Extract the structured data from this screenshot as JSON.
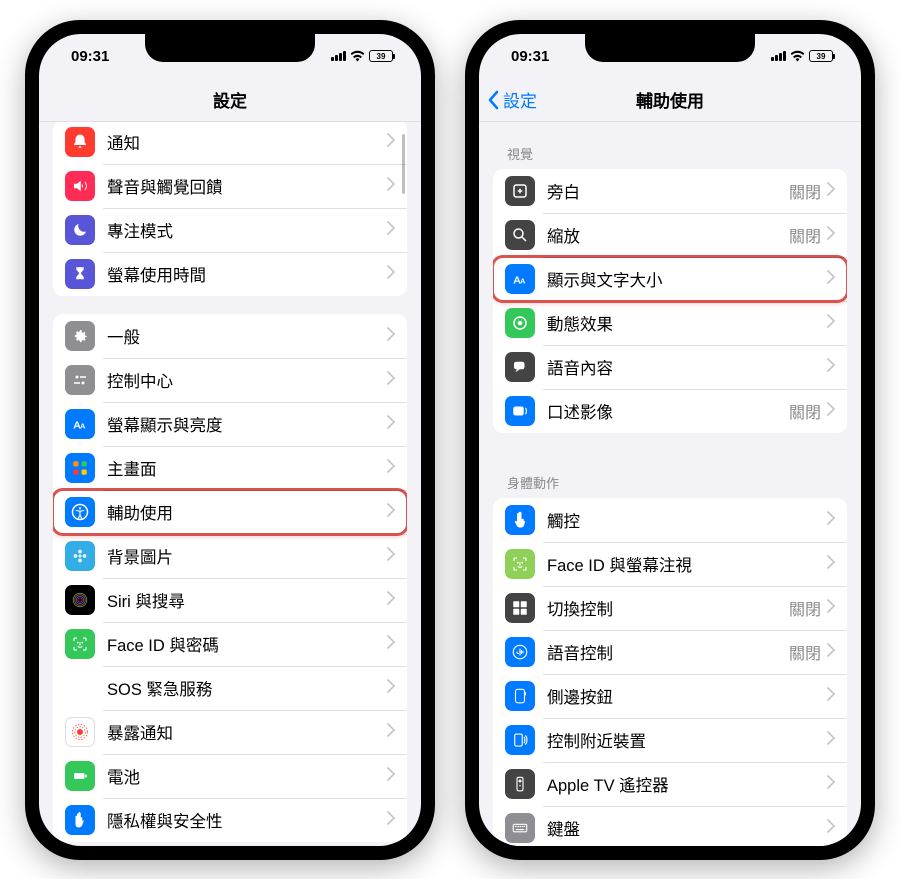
{
  "status": {
    "time": "09:31",
    "battery": "39"
  },
  "left": {
    "title": "設定",
    "groups": [
      {
        "rows": [
          {
            "name": "notifications",
            "icon": "bell-icon",
            "bg": "bg-red",
            "label": "通知"
          },
          {
            "name": "sounds",
            "icon": "speaker-icon",
            "bg": "bg-pink",
            "label": "聲音與觸覺回饋"
          },
          {
            "name": "focus",
            "icon": "moon-icon",
            "bg": "bg-purple",
            "label": "專注模式"
          },
          {
            "name": "screen-time",
            "icon": "hourglass-icon",
            "bg": "bg-purple",
            "label": "螢幕使用時間"
          }
        ]
      },
      {
        "rows": [
          {
            "name": "general",
            "icon": "gear-icon",
            "bg": "bg-gray",
            "label": "一般"
          },
          {
            "name": "control-center",
            "icon": "switches-icon",
            "bg": "bg-gray",
            "label": "控制中心"
          },
          {
            "name": "display",
            "icon": "text-size-icon",
            "bg": "bg-blue",
            "label": "螢幕顯示與亮度"
          },
          {
            "name": "home-screen",
            "icon": "grid-icon",
            "bg": "bg-blue",
            "label": "主畫面"
          },
          {
            "name": "accessibility",
            "icon": "accessibility-icon",
            "bg": "bg-blue",
            "label": "輔助使用",
            "highlight": true
          },
          {
            "name": "wallpaper",
            "icon": "flower-icon",
            "bg": "bg-teal",
            "label": "背景圖片"
          },
          {
            "name": "siri",
            "icon": "siri-icon",
            "bg": "bg-black",
            "label": "Siri 與搜尋"
          },
          {
            "name": "faceid",
            "icon": "faceid-icon",
            "bg": "bg-green",
            "label": "Face ID 與密碼"
          },
          {
            "name": "sos",
            "icon": "sos-icon",
            "bg": "bg-sos",
            "label": "SOS 緊急服務",
            "text": "SOS"
          },
          {
            "name": "exposure",
            "icon": "exposure-icon",
            "bg": "bg-white",
            "label": "暴露通知"
          },
          {
            "name": "battery",
            "icon": "battery-icon",
            "bg": "bg-green",
            "label": "電池"
          },
          {
            "name": "privacy",
            "icon": "hand-icon",
            "bg": "bg-blue",
            "label": "隱私權與安全性"
          }
        ]
      }
    ]
  },
  "right": {
    "back": "設定",
    "title": "輔助使用",
    "sections": [
      {
        "header": "視覺",
        "rows": [
          {
            "name": "voiceover",
            "icon": "voiceover-icon",
            "bg": "bg-darkgray",
            "label": "旁白",
            "detail": "關閉"
          },
          {
            "name": "zoom",
            "icon": "zoom-icon",
            "bg": "bg-darkgray",
            "label": "縮放",
            "detail": "關閉"
          },
          {
            "name": "display-text",
            "icon": "text-size-icon",
            "bg": "bg-blue",
            "label": "顯示與文字大小",
            "highlight": true
          },
          {
            "name": "motion",
            "icon": "motion-icon",
            "bg": "bg-green",
            "label": "動態效果"
          },
          {
            "name": "spoken-content",
            "icon": "speech-icon",
            "bg": "bg-darkgray",
            "label": "語音內容"
          },
          {
            "name": "audio-desc",
            "icon": "audio-desc-icon",
            "bg": "bg-blue",
            "label": "口述影像",
            "detail": "關閉"
          }
        ]
      },
      {
        "header": "身體動作",
        "rows": [
          {
            "name": "touch",
            "icon": "touch-icon",
            "bg": "bg-blue",
            "label": "觸控"
          },
          {
            "name": "faceid-attention",
            "icon": "faceid-icon",
            "bg": "bg-lime",
            "label": "Face ID 與螢幕注視"
          },
          {
            "name": "switch-control",
            "icon": "switch-icon",
            "bg": "bg-darkgray",
            "label": "切換控制",
            "detail": "關閉"
          },
          {
            "name": "voice-control",
            "icon": "voice-control-icon",
            "bg": "bg-blue",
            "label": "語音控制",
            "detail": "關閉"
          },
          {
            "name": "side-button",
            "icon": "side-button-icon",
            "bg": "bg-blue",
            "label": "側邊按鈕"
          },
          {
            "name": "nearby-control",
            "icon": "nearby-icon",
            "bg": "bg-blue",
            "label": "控制附近裝置"
          },
          {
            "name": "apple-tv-remote",
            "icon": "remote-icon",
            "bg": "bg-darkgray",
            "label": "Apple TV 遙控器"
          },
          {
            "name": "keyboard",
            "icon": "keyboard-icon",
            "bg": "bg-gray",
            "label": "鍵盤"
          }
        ]
      }
    ]
  }
}
